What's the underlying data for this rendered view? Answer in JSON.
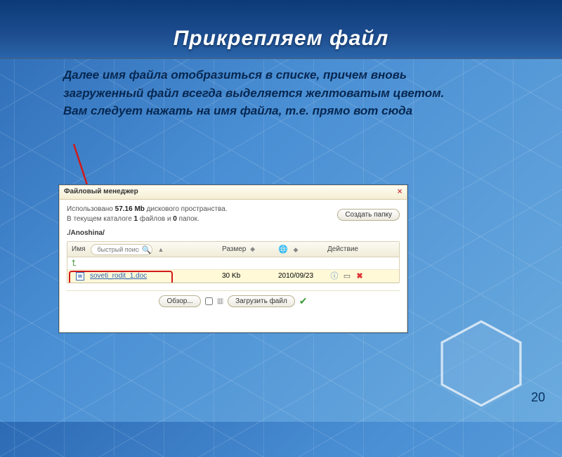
{
  "slide": {
    "title": "Прикрепляем файл",
    "description": "Далее имя файла отобразиться в списке, причем вновь загруженный файл всегда выделяется желтоватым цветом. Вам следует нажать на имя файла, т.е. прямо вот сюда",
    "page_number": "20"
  },
  "dialog": {
    "title": "Файловый менеджер",
    "usage_prefix": "Использовано ",
    "usage_size": "57.16 Mb",
    "usage_suffix": " дискового пространства.",
    "catalog_line_pre": "В текущем каталоге ",
    "files_count": "1",
    "files_word": " файлов и ",
    "folders_count": "0",
    "folders_word": " папок.",
    "create_folder_btn": "Создать папку",
    "path": "./Anoshina/",
    "columns": {
      "name": "Имя",
      "search_placeholder": "быстрый поиск",
      "size": "Размер",
      "actions": "Действие"
    },
    "file": {
      "name": "soveti_rodit_1.doc",
      "size": "30 Kb",
      "date": "2010/09/23"
    },
    "footer": {
      "browse": "Обзор...",
      "upload": "Загрузить файл"
    }
  }
}
